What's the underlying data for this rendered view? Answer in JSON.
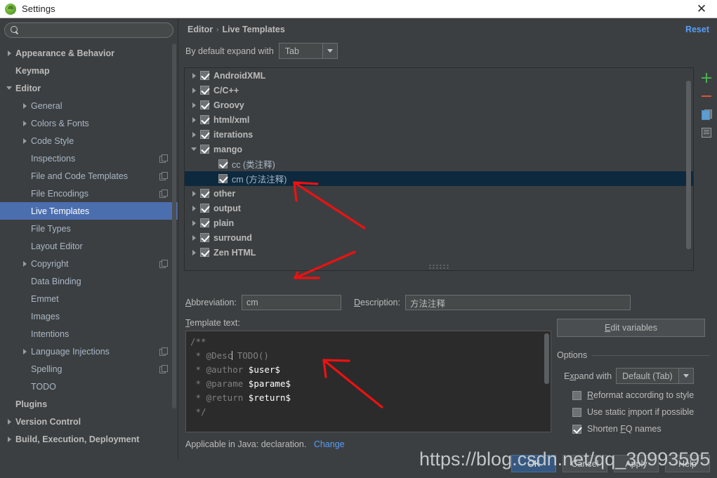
{
  "window": {
    "title": "Settings",
    "app_icon": "android-studio-icon",
    "close_label": "✕"
  },
  "sidebar": {
    "search": {
      "value": "",
      "placeholder": "",
      "icon": "search-icon"
    },
    "items": [
      {
        "label": "Appearance & Behavior",
        "indent": 0,
        "arrow": "right",
        "bold": true,
        "selected": false,
        "copy": false
      },
      {
        "label": "Keymap",
        "indent": 0,
        "arrow": "none",
        "bold": true,
        "selected": false,
        "copy": false
      },
      {
        "label": "Editor",
        "indent": 0,
        "arrow": "down",
        "bold": true,
        "selected": false,
        "copy": false
      },
      {
        "label": "General",
        "indent": 1,
        "arrow": "right",
        "bold": false,
        "selected": false,
        "copy": false
      },
      {
        "label": "Colors & Fonts",
        "indent": 1,
        "arrow": "right",
        "bold": false,
        "selected": false,
        "copy": false
      },
      {
        "label": "Code Style",
        "indent": 1,
        "arrow": "right",
        "bold": false,
        "selected": false,
        "copy": false
      },
      {
        "label": "Inspections",
        "indent": 1,
        "arrow": "none",
        "bold": false,
        "selected": false,
        "copy": true
      },
      {
        "label": "File and Code Templates",
        "indent": 1,
        "arrow": "none",
        "bold": false,
        "selected": false,
        "copy": true
      },
      {
        "label": "File Encodings",
        "indent": 1,
        "arrow": "none",
        "bold": false,
        "selected": false,
        "copy": true
      },
      {
        "label": "Live Templates",
        "indent": 1,
        "arrow": "none",
        "bold": false,
        "selected": true,
        "copy": false
      },
      {
        "label": "File Types",
        "indent": 1,
        "arrow": "none",
        "bold": false,
        "selected": false,
        "copy": false
      },
      {
        "label": "Layout Editor",
        "indent": 1,
        "arrow": "none",
        "bold": false,
        "selected": false,
        "copy": false
      },
      {
        "label": "Copyright",
        "indent": 1,
        "arrow": "right",
        "bold": false,
        "selected": false,
        "copy": true
      },
      {
        "label": "Data Binding",
        "indent": 1,
        "arrow": "none",
        "bold": false,
        "selected": false,
        "copy": false
      },
      {
        "label": "Emmet",
        "indent": 1,
        "arrow": "none",
        "bold": false,
        "selected": false,
        "copy": false
      },
      {
        "label": "Images",
        "indent": 1,
        "arrow": "none",
        "bold": false,
        "selected": false,
        "copy": false
      },
      {
        "label": "Intentions",
        "indent": 1,
        "arrow": "none",
        "bold": false,
        "selected": false,
        "copy": false
      },
      {
        "label": "Language Injections",
        "indent": 1,
        "arrow": "right",
        "bold": false,
        "selected": false,
        "copy": true
      },
      {
        "label": "Spelling",
        "indent": 1,
        "arrow": "none",
        "bold": false,
        "selected": false,
        "copy": true
      },
      {
        "label": "TODO",
        "indent": 1,
        "arrow": "none",
        "bold": false,
        "selected": false,
        "copy": false
      },
      {
        "label": "Plugins",
        "indent": 0,
        "arrow": "none",
        "bold": true,
        "selected": false,
        "copy": false
      },
      {
        "label": "Version Control",
        "indent": 0,
        "arrow": "right",
        "bold": true,
        "selected": false,
        "copy": false
      },
      {
        "label": "Build, Execution, Deployment",
        "indent": 0,
        "arrow": "right",
        "bold": true,
        "selected": false,
        "copy": false
      }
    ]
  },
  "main": {
    "breadcrumb": {
      "parent": "Editor",
      "separator": "›",
      "current": "Live Templates"
    },
    "reset_label": "Reset",
    "expand_with": {
      "label": "By default expand with",
      "value": "Tab"
    },
    "templates": [
      {
        "label": "AndroidXML",
        "arrow": "right",
        "checked": true,
        "leaf": false,
        "selected": false
      },
      {
        "label": "C/C++",
        "arrow": "right",
        "checked": true,
        "leaf": false,
        "selected": false
      },
      {
        "label": "Groovy",
        "arrow": "right",
        "checked": true,
        "leaf": false,
        "selected": false
      },
      {
        "label": "html/xml",
        "arrow": "right",
        "checked": true,
        "leaf": false,
        "selected": false
      },
      {
        "label": "iterations",
        "arrow": "right",
        "checked": true,
        "leaf": false,
        "selected": false
      },
      {
        "label": "mango",
        "arrow": "down",
        "checked": true,
        "leaf": false,
        "selected": false
      },
      {
        "label": "cc (类注释)",
        "arrow": "none",
        "checked": true,
        "leaf": true,
        "selected": false
      },
      {
        "label": "cm (方法注释)",
        "arrow": "none",
        "checked": true,
        "leaf": true,
        "selected": true
      },
      {
        "label": "other",
        "arrow": "right",
        "checked": true,
        "leaf": false,
        "selected": false
      },
      {
        "label": "output",
        "arrow": "right",
        "checked": true,
        "leaf": false,
        "selected": false
      },
      {
        "label": "plain",
        "arrow": "right",
        "checked": true,
        "leaf": false,
        "selected": false
      },
      {
        "label": "surround",
        "arrow": "right",
        "checked": true,
        "leaf": false,
        "selected": false
      },
      {
        "label": "Zen HTML",
        "arrow": "right",
        "checked": true,
        "leaf": false,
        "selected": false
      }
    ],
    "toolbar": [
      {
        "name": "add-template-button",
        "icon": "plus-icon",
        "color": "#4caf50"
      },
      {
        "name": "remove-template-button",
        "icon": "minus-icon",
        "color": "#d9543b"
      },
      {
        "name": "duplicate-template-button",
        "icon": "copy-icon",
        "color": "#5d9dcf"
      },
      {
        "name": "template-group-button",
        "icon": "list-icon",
        "color": "#9a9da0"
      }
    ],
    "abbreviation": {
      "label": "Abbreviation:",
      "value": "cm"
    },
    "description": {
      "label": "Description:",
      "value": "方法注释"
    },
    "template_text": {
      "label": "Template text:",
      "lines": [
        "/**",
        " * @Desc TODO()",
        " * @author $user$",
        " * @parame $parame$",
        " * @return $return$",
        " */"
      ]
    },
    "applicable": {
      "text": "Applicable in Java: declaration.",
      "change_label": "Change"
    },
    "options": {
      "edit_variables_label": "Edit variables",
      "section_title": "Options",
      "expand_with": {
        "label": "Expand with",
        "value": "Default (Tab)"
      },
      "checkboxes": [
        {
          "label": "Reformat according to style",
          "checked": false
        },
        {
          "label": "Use static import if possible",
          "checked": false
        },
        {
          "label": "Shorten FQ names",
          "checked": true
        }
      ]
    }
  },
  "footer": {
    "buttons": [
      {
        "label": "OK",
        "primary": true
      },
      {
        "label": "Cancel",
        "primary": false
      },
      {
        "label": "Apply",
        "primary": false
      },
      {
        "label": "Help",
        "primary": false
      }
    ]
  },
  "watermark": {
    "text": "https://blog.csdn.net/qq_30993595"
  },
  "colors": {
    "background": "#3c3f41",
    "selection": "#4b6eaf",
    "tree_selection": "#0d293e",
    "link": "#589df6",
    "editor_bg": "#2b2b2b",
    "annotation": "#ee1111"
  }
}
